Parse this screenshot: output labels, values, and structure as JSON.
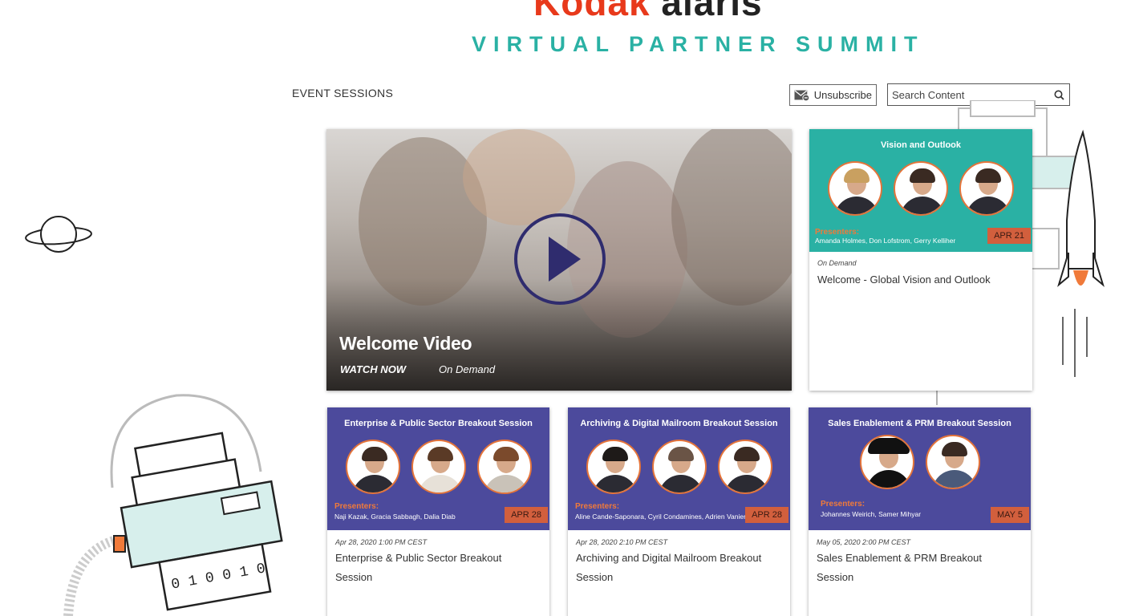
{
  "header": {
    "logo_kodak": "Kodak",
    "logo_alaris": "alaris",
    "subtitle": "VIRTUAL PARTNER  SUMMIT"
  },
  "section_title": "EVENT SESSIONS",
  "toolbar": {
    "unsubscribe_label": "Unsubscribe",
    "search_placeholder": "Search Content"
  },
  "hero": {
    "title": "Welcome Video",
    "watch_label": "WATCH NOW",
    "status": "On Demand"
  },
  "sessions": [
    {
      "banner_title": "Vision and Outlook",
      "presenters_label": "Presenters:",
      "presenters": "Amanda Holmes, Don Lofstrom, Gerry Kelliher",
      "date_badge": "APR 21",
      "meta": "On Demand",
      "title": "Welcome - Global Vision and Outlook",
      "banner_color": "#2ab1a4"
    },
    {
      "banner_title": "Enterprise & Public Sector Breakout Session",
      "presenters_label": "Presenters:",
      "presenters": "Naji Kazak, Gracia Sabbagh, Dalia Diab",
      "date_badge": "APR 28",
      "meta": "Apr 28, 2020 1:00 PM CEST",
      "title": "Enterprise & Public Sector Breakout Session",
      "banner_color": "#4c4a9c"
    },
    {
      "banner_title": "Archiving & Digital Mailroom Breakout Session",
      "presenters_label": "Presenters:",
      "presenters": "Aline Cande-Saponara, Cyril Condamines, Adrien Vanier",
      "date_badge": "APR 28",
      "meta": "Apr 28, 2020 2:10 PM CEST",
      "title": "Archiving and Digital Mailroom Breakout Session",
      "banner_color": "#4c4a9c"
    },
    {
      "banner_title": "Sales Enablement & PRM Breakout Session",
      "presenters_label": "Presenters:",
      "presenters": "Johannes Weirich, Samer Mihyar",
      "date_badge": "MAY 5",
      "meta": "May 05, 2020 2:00 PM CEST",
      "title": "Sales Enablement & PRM Breakout Session",
      "banner_color": "#4c4a9c"
    }
  ],
  "colors": {
    "brand_red": "#e8391b",
    "teal": "#2ab1a4",
    "purple": "#4c4a9c",
    "badge_orange": "#d25f3d",
    "play_navy": "#2f2c6e"
  },
  "decor_digits": "0 1 0 0 1 0"
}
